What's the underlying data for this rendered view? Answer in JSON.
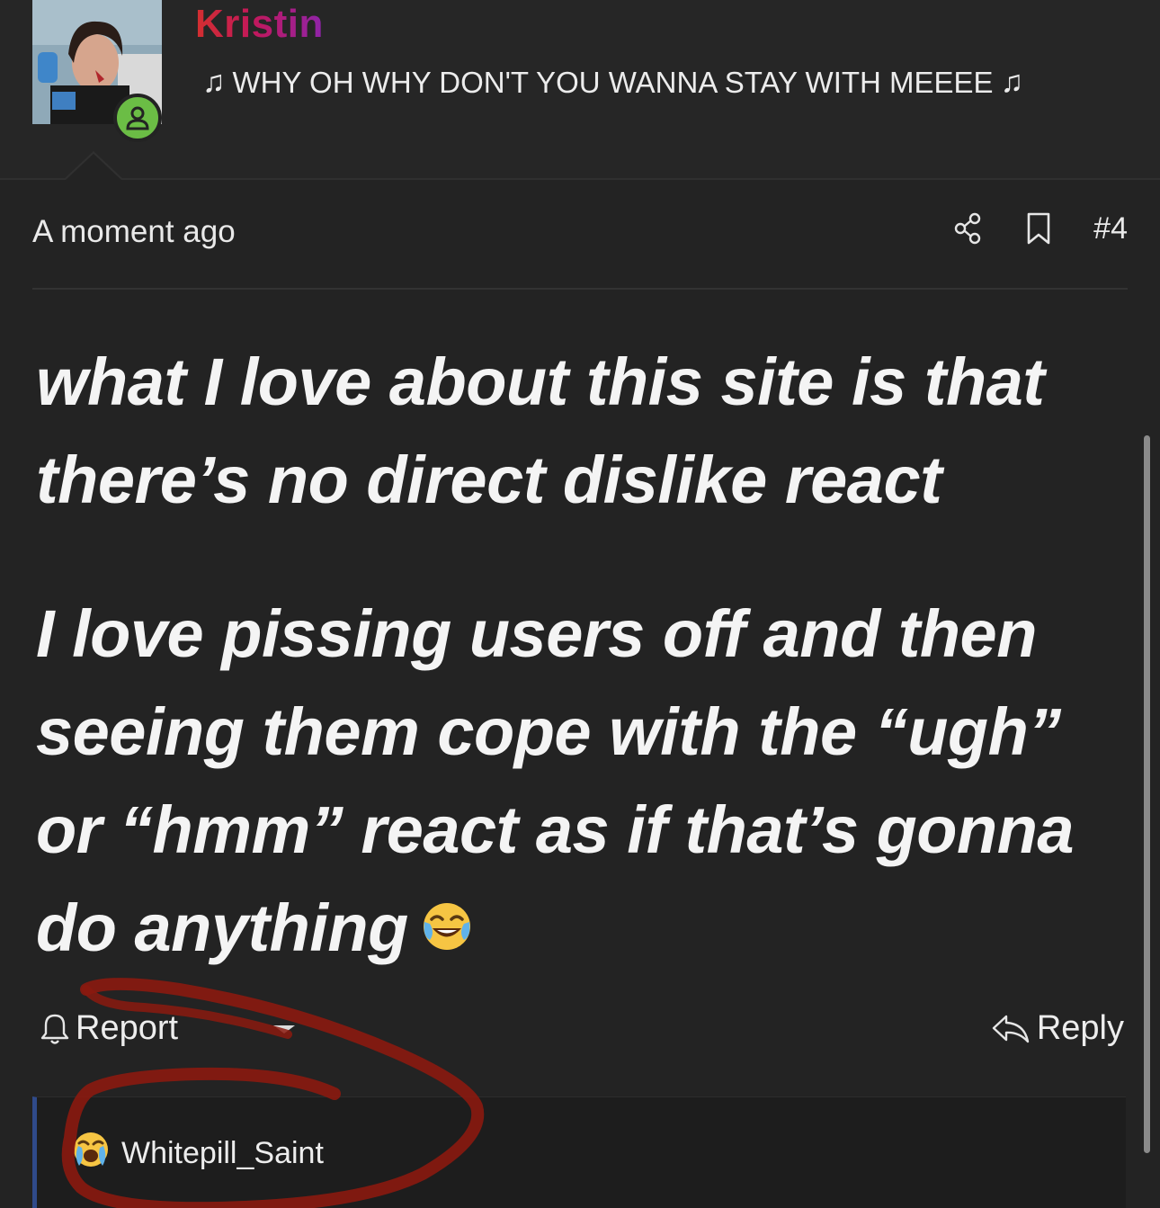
{
  "user": {
    "name": "Kristin",
    "title_text": "WHY OH WHY DON'T YOU WANNA STAY WITH MEEEE",
    "title_note": "♫",
    "status": "online"
  },
  "post": {
    "timestamp": "A moment ago",
    "number": "#4",
    "paragraphs": [
      "what I love about this site is that there’s no direct dislike react",
      "I love pissing users off and then seeing them cope with the “ugh” or “hmm” react as if that’s gonna do anything"
    ],
    "trailing_emoji": "face-with-tears-of-joy"
  },
  "actions": {
    "report_label": "Report",
    "reply_label": "Reply",
    "share_icon": "share-icon",
    "bookmark_icon": "bookmark-icon"
  },
  "reactions": {
    "emoji": "loudly-crying-face",
    "user": "Whitepill_Saint"
  },
  "colors": {
    "background": "#232323",
    "username_gradient_start": "#d32f2f",
    "username_gradient_end": "#8e24aa",
    "online": "#6bbd45",
    "annotation": "#8b1a0f"
  }
}
